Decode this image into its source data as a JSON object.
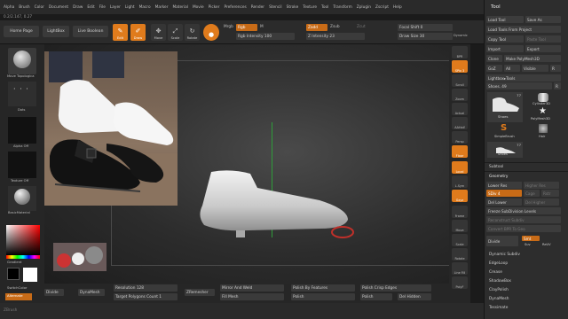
{
  "menu": [
    "Alpha",
    "Brush",
    "Color",
    "Document",
    "Draw",
    "Edit",
    "File",
    "Layer",
    "Light",
    "Macro",
    "Marker",
    "Material",
    "Movie",
    "Picker",
    "Preferences",
    "Render",
    "Stencil",
    "Stroke",
    "Texture",
    "Tool",
    "Transform",
    "Zplugin",
    "Zscript",
    "Help"
  ],
  "version": "0.2/2.147, 0.27",
  "topshelf": {
    "home": "Home Page",
    "lightbox": "LightBox",
    "live_boolean": "Live Boolean",
    "edit": "Edit",
    "draw": "Draw",
    "move": "Move",
    "scale": "Scale",
    "rotate": "Rotate",
    "mrgb": "Mrgb",
    "rgb": "Rgb",
    "m": "M",
    "zadd": "Zadd",
    "zsub": "Zsub",
    "zcut": "Zcut",
    "rgb_intensity": "Rgb Intensity 100",
    "z_intensity": "Z Intensity 23",
    "focal_shift": "Focal Shift 0",
    "draw_size": "Draw Size 30",
    "dynamic": "Dynamic"
  },
  "leftshelf": {
    "brush": "Move Topologica",
    "dots": "Dots",
    "alpha": "Alpha Off",
    "texture": "Texture Off",
    "material": "BasicMaterial",
    "gradient": "Gradient",
    "switch_color": "SwitchColor",
    "alternate": "Alternate"
  },
  "rightshelf": [
    "BPR",
    "SPix 3",
    "Scroll",
    "Zoom",
    "Actual",
    "AAHalf",
    "Persp",
    "Floor",
    "Local",
    "L.Sym",
    "Gxyz",
    "Frame",
    "Move",
    "Scale",
    "Rotate",
    "Line Fill",
    "PolyF",
    "Transp",
    "Dynamic",
    "Solo",
    "Xpose"
  ],
  "bottom": {
    "divide": "Divide",
    "dynamesh": "DynaMesh",
    "resolution": "Resolution 128",
    "target": "Target Polygons Count 1",
    "zremesher": "ZRemesher",
    "mirror_weld": "Mirror And Weld",
    "fill_mesh": "Fill Mesh",
    "polish_features": "Polish By Features",
    "polish": "Polish",
    "polish_crisp": "Polish Crisp Edges",
    "polish_btn": "Polish",
    "del_hidden": "Del Hidden"
  },
  "footer": "ZBrush",
  "panel": {
    "title": "Tool",
    "load_tool": "Load Tool",
    "save_as": "Save As",
    "load_project": "Load Tools From Project",
    "copy_tool": "Copy Tool",
    "paste_tool": "Paste Tool",
    "import": "Import",
    "export": "Export",
    "clone": "Clone",
    "make_polymesh": "Make PolyMesh3D",
    "goz": "GoZ",
    "all": "All",
    "visible": "Visible",
    "r": "R",
    "lightbox_tools": "Lightbox▸Tools",
    "shoes": "Shoes. 49",
    "r2": "R",
    "thumbs": [
      {
        "label": "Shoes",
        "count": "77"
      },
      {
        "label": "Cylinder3D",
        "count": ""
      },
      {
        "label": "Shoes",
        "count": ""
      },
      {
        "label": "PolyMesh3D",
        "count": ""
      },
      {
        "label": "SimpleBrush",
        "count": ""
      },
      {
        "label": "Hair",
        "count": ""
      },
      {
        "label": "Shoes",
        "count": "77"
      }
    ],
    "subtool": "Subtool",
    "geometry": "Geometry",
    "lower_res": "Lower Res",
    "higher_res": "Higher Res",
    "sdiv": "SDiv 4",
    "cage": "Cage",
    "rstr": "Rstr",
    "del_lower": "Del Lower",
    "del_higher": "Del Higher",
    "freeze": "Freeze SubDivision Levels",
    "reconstruct": "Reconstruct Subdiv",
    "convert_bpr": "Convert BPR To Geo",
    "divide": "Divide",
    "smt": "Smt",
    "suv": "Suv",
    "reuv": "ReUV",
    "items": [
      "Dynamic Subdiv",
      "EdgeLoop",
      "Crease",
      "ShadowBox",
      "ClayPolish",
      "DynaMesh",
      "Tessimate"
    ]
  },
  "colors": {
    "accent": "#e07b1c"
  }
}
